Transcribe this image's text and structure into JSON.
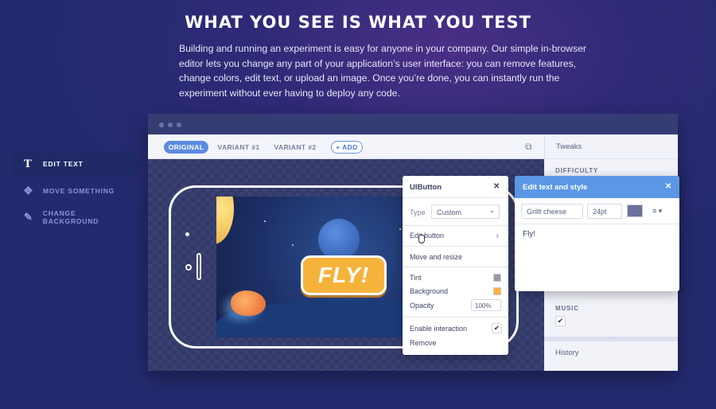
{
  "hero": {
    "title": "WHAT YOU SEE IS WHAT YOU TEST",
    "description": "Building and running an experiment is easy for anyone in your company. Our simple in-browser editor lets you change any part of your application’s user interface: you can remove features, change colors, edit text, or upload an image. Once you’re done, you can instantly run the experiment without ever having to deploy any code."
  },
  "side_menu": {
    "items": [
      {
        "label": "EDIT TEXT",
        "icon": "text-icon",
        "glyph": "T",
        "active": true
      },
      {
        "label": "MOVE SOMETHING",
        "icon": "move-icon",
        "glyph": "✥",
        "active": false
      },
      {
        "label": "CHANGE BACKGROUND",
        "icon": "eyedropper-icon",
        "glyph": "✎",
        "active": false
      }
    ]
  },
  "editor": {
    "tabs": [
      "ORIGINAL",
      "VARIANT #1",
      "VARIANT #2"
    ],
    "add_label": "+ ADD",
    "sidebar": {
      "title": "Tweaks",
      "difficulty_label": "DIFFICULTY",
      "music_label": "MUSIC",
      "music_checked": "✔",
      "history_label": "History",
      "resize_handle": "....",
      "copy_icon": "⧉"
    },
    "game": {
      "fly_label": "FLY!"
    },
    "uibutton_panel": {
      "title": "UIButton",
      "close": "✕",
      "type_label": "Type",
      "type_value": "Custom",
      "edit_button_label": "Edit button",
      "move_resize_label": "Move and resize",
      "tint_label": "Tint",
      "background_label": "Background",
      "opacity_label": "Opacity",
      "opacity_value": "100%",
      "enable_interaction_label": "Enable interaction",
      "enable_interaction_checked": "✔",
      "remove_label": "Remove",
      "chevron": "›",
      "dropdown_caret": "⌄"
    },
    "edit_text_popover": {
      "title": "Edit text and style",
      "close": "✕",
      "font_value": "Grillt cheese",
      "size_value": "24pt",
      "align_glyph": "≡ ▾",
      "text_value": "Fly!"
    }
  },
  "colors": {
    "accent_blue": "#5b97e4",
    "tint_swatch": "#9a9aa6",
    "background_swatch": "#f6b33c",
    "text_color_swatch": "#6b6f9b",
    "fly_button": "#f6b33c"
  }
}
